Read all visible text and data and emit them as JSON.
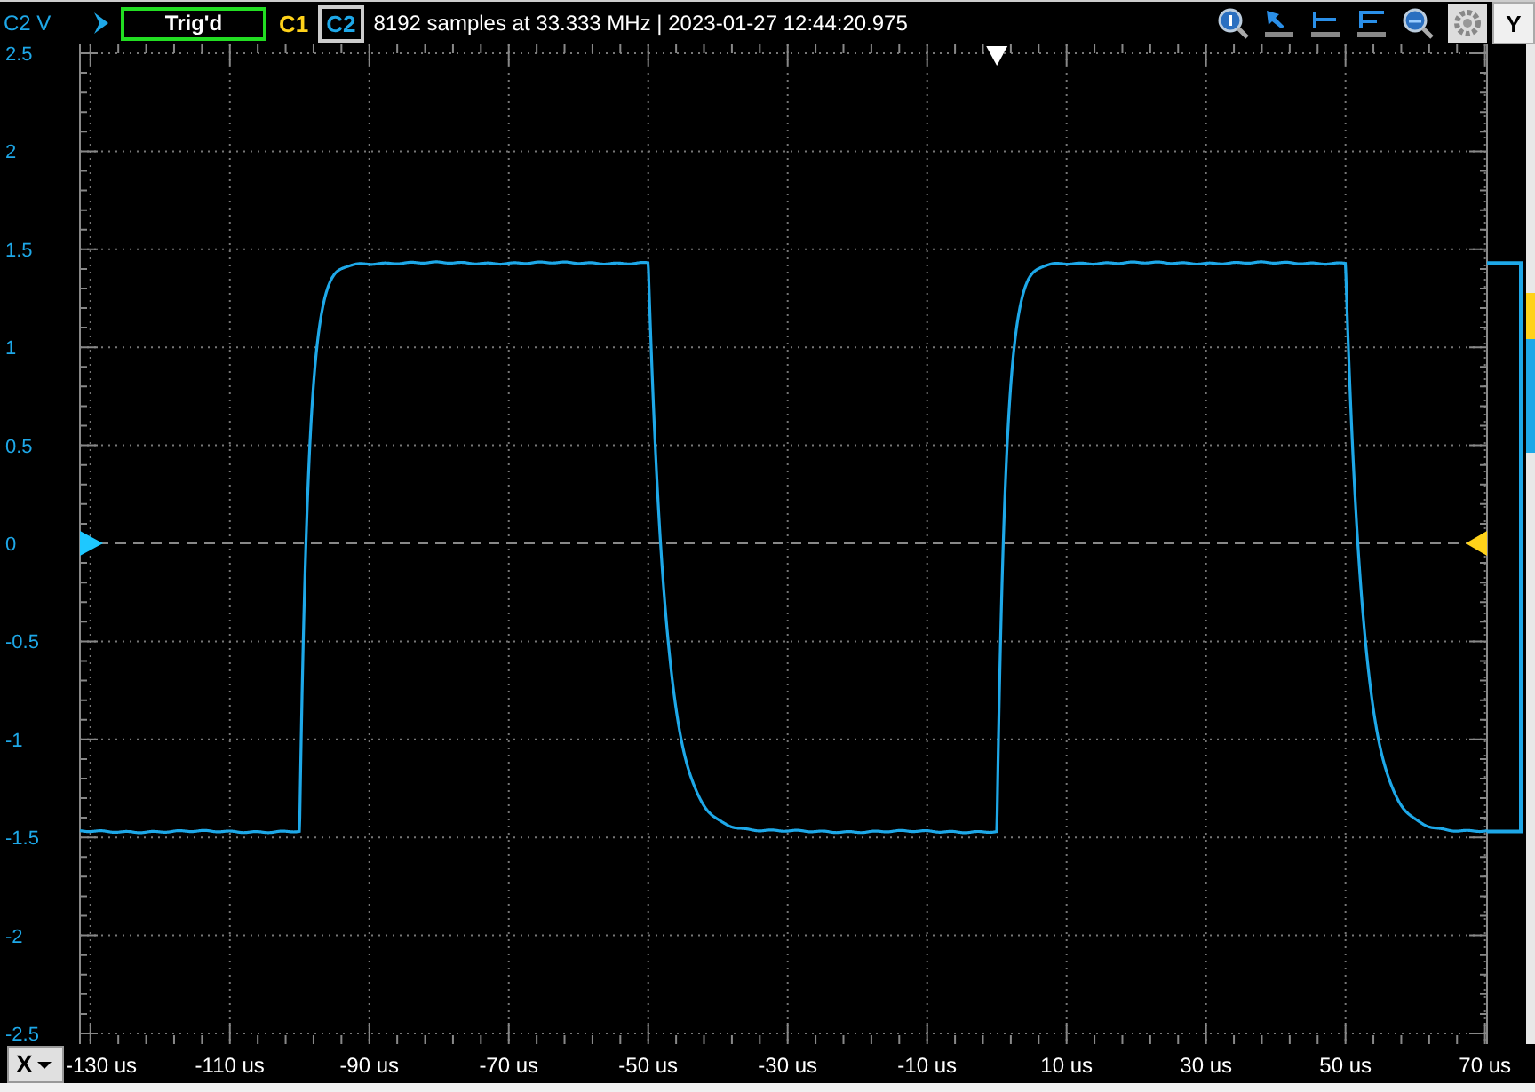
{
  "top_bar": {
    "axis_unit": "C2 V",
    "trigger_status": "Trig'd",
    "channels": [
      {
        "label": "C1",
        "selected": false,
        "color": "#ffd21a"
      },
      {
        "label": "C2",
        "selected": true,
        "color": "#1ea8e8"
      }
    ],
    "acquisition_info": "8192 samples at 33.333 MHz | 2023-01-27 12:44:20.975",
    "y_button": "Y"
  },
  "y_axis": {
    "labels": [
      "2.5",
      "2",
      "1.5",
      "1",
      "0.5",
      "0",
      "-0.5",
      "-1",
      "-1.5",
      "-2",
      "-2.5"
    ]
  },
  "x_axis": {
    "button": "X",
    "labels": [
      "-130 us",
      "-110 us",
      "-90 us",
      "-70 us",
      "-50 us",
      "-30 us",
      "-10 us",
      "10 us",
      "30 us",
      "50 us",
      "70 us"
    ]
  }
}
